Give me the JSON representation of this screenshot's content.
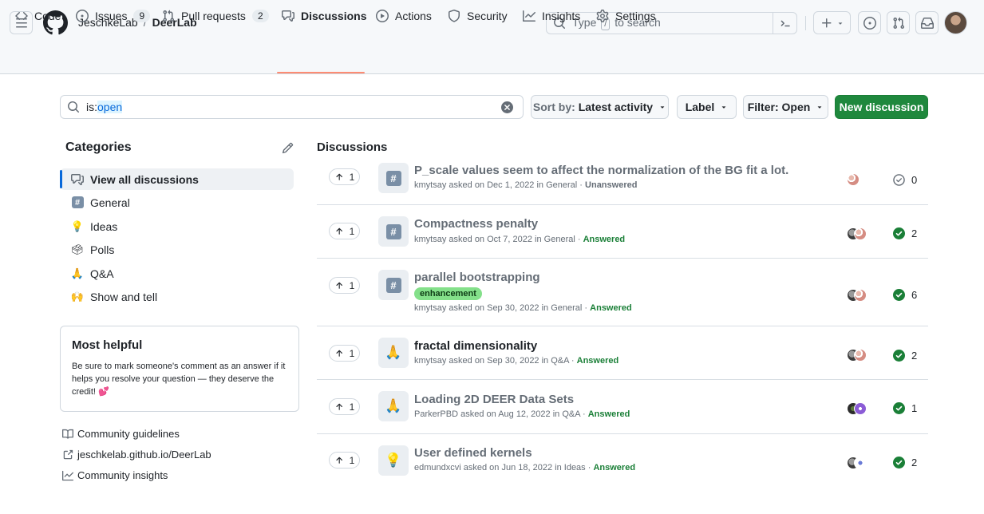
{
  "header": {
    "owner": "JeschkeLab",
    "separator": "/",
    "repo": "DeerLab",
    "search_prefix": "Type",
    "search_key": "/",
    "search_suffix": "to search"
  },
  "tabs": [
    {
      "label": "Code",
      "icon": "code-icon"
    },
    {
      "label": "Issues",
      "count": "9",
      "icon": "issue-icon"
    },
    {
      "label": "Pull requests",
      "count": "2",
      "icon": "pull-request-icon"
    },
    {
      "label": "Discussions",
      "icon": "comment-discussion-icon",
      "active": true
    },
    {
      "label": "Actions",
      "icon": "play-icon"
    },
    {
      "label": "Security",
      "icon": "shield-icon"
    },
    {
      "label": "Insights",
      "icon": "graph-icon"
    },
    {
      "label": "Settings",
      "icon": "gear-icon"
    }
  ],
  "toolbar": {
    "query_key": "is:",
    "query_value": "open",
    "sort_prefix": "Sort by:",
    "sort_value": "Latest activity",
    "label_button": "Label",
    "filter_button": "Filter: Open",
    "new_button": "New discussion"
  },
  "categories": {
    "title": "Categories",
    "items": [
      {
        "label": "View all discussions",
        "icon": "comment-discussion-icon",
        "active": true
      },
      {
        "label": "General",
        "icon": "hash-icon"
      },
      {
        "label": "Ideas",
        "icon": "light-bulb-emoji"
      },
      {
        "label": "Polls",
        "icon": "ballot-box-emoji"
      },
      {
        "label": "Q&A",
        "icon": "folded-hands-emoji"
      },
      {
        "label": "Show and tell",
        "icon": "raising-hands-emoji"
      }
    ]
  },
  "helpful": {
    "title": "Most helpful",
    "text": "Be sure to mark someone's comment as an answer if it helps you resolve your question — they deserve the credit! 💕"
  },
  "side_links": [
    {
      "label": "Community guidelines",
      "icon": "book-icon"
    },
    {
      "label": "jeschkelab.github.io/DeerLab",
      "icon": "link-external-icon"
    },
    {
      "label": "Community insights",
      "icon": "graph-icon"
    }
  ],
  "discussions": {
    "title": "Discussions",
    "items": [
      {
        "votes": "1",
        "category_icon": "hash-icon",
        "title": "P_scale values seem to affect the normalization of the BG fit a lot.",
        "author": "kmytsay",
        "asked": "asked on Dec 1, 2022 in",
        "category": "General",
        "status": "Unanswered",
        "answered": false,
        "comments": "0",
        "read": true
      },
      {
        "votes": "1",
        "category_icon": "hash-icon",
        "title": "Compactness penalty",
        "author": "kmytsay",
        "asked": "asked on Oct 7, 2022 in",
        "category": "General",
        "status": "Answered",
        "answered": true,
        "comments": "2",
        "read": true
      },
      {
        "votes": "1",
        "category_icon": "hash-icon",
        "title": "parallel bootstrapping",
        "label": "enhancement",
        "author": "kmytsay",
        "asked": "asked on Sep 30, 2022 in",
        "category": "General",
        "status": "Answered",
        "answered": true,
        "comments": "6",
        "read": true
      },
      {
        "votes": "1",
        "category_icon": "folded-hands-emoji",
        "title": "fractal dimensionality",
        "author": "kmytsay",
        "asked": "asked on Sep 30, 2022 in",
        "category": "Q&A",
        "status": "Answered",
        "answered": true,
        "comments": "2",
        "read": false
      },
      {
        "votes": "1",
        "category_icon": "folded-hands-emoji",
        "title": "Loading 2D DEER Data Sets",
        "author": "ParkerPBD",
        "asked": "asked on Aug 12, 2022 in",
        "category": "Q&A",
        "status": "Answered",
        "answered": true,
        "comments": "1",
        "read": true
      },
      {
        "votes": "1",
        "category_icon": "light-bulb-emoji",
        "title": "User defined kernels",
        "author": "edmundxcvi",
        "asked": "asked on Jun 18, 2022 in",
        "category": "Ideas",
        "status": "Answered",
        "answered": true,
        "comments": "2",
        "read": true
      }
    ]
  },
  "colors": {
    "accent": "#0969da",
    "primary_button": "#1f883d",
    "answered": "#1a7f37",
    "active_tab_underline": "#fd8c73",
    "label_enhancement": "#84e08a"
  }
}
